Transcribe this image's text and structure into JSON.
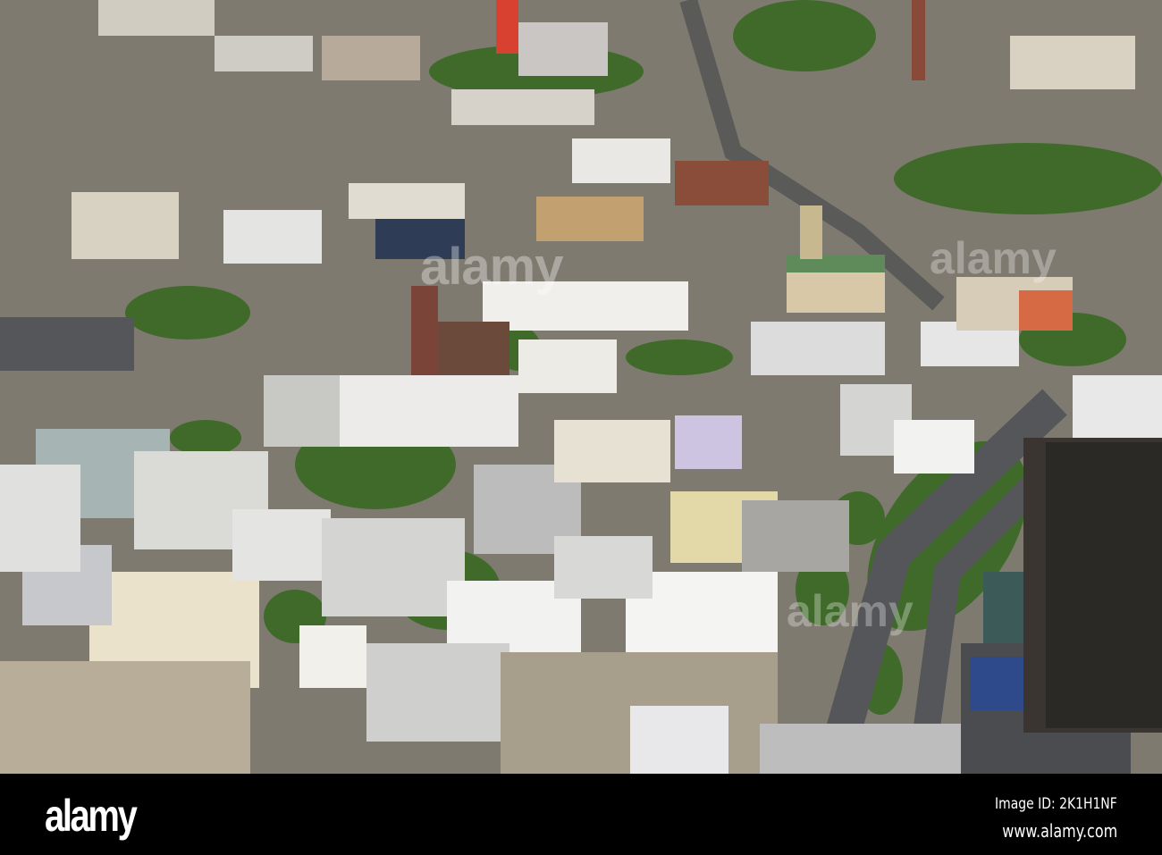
{
  "image": {
    "description_icon": "aerial-city-photo"
  },
  "watermark": {
    "text": "alamy"
  },
  "footer": {
    "logo": "alamy",
    "image_id": "Image ID: 2K1H1NF",
    "url": "www.alamy.com"
  }
}
